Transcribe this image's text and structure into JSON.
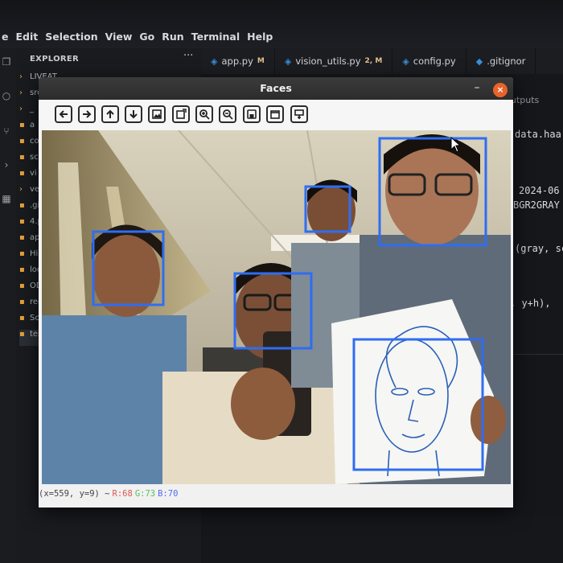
{
  "menu": [
    "e",
    "Edit",
    "Selection",
    "View",
    "Go",
    "Run",
    "Terminal",
    "Help"
  ],
  "explorer": {
    "title": "EXPLORER",
    "more_icon": "ellipsis-icon",
    "rows": [
      "LIVEAT",
      "src",
      "_",
      "a",
      "co",
      "sc",
      "vi",
      "ver",
      ".git",
      "4.p",
      "app",
      "Hir",
      "loc",
      "OD",
      "rec",
      "Scr",
      "tes"
    ]
  },
  "tabs": [
    {
      "label": "app.py",
      "badge": "M",
      "icon": "python-file-icon"
    },
    {
      "label": "vision_utils.py",
      "badge": "2, M",
      "icon": "python-file-icon"
    },
    {
      "label": "config.py",
      "badge": "",
      "icon": "python-file-icon"
    },
    {
      "label": ".gitignor",
      "badge": "",
      "icon": "git-file-icon"
    }
  ],
  "editor": {
    "outputs_label": "utputs",
    "code_fragments": [
      "data.haa",
      "2024-06",
      "BGR2GRAY",
      "(gray, sc",
      ", y+h),"
    ]
  },
  "window": {
    "title": "Faces",
    "minimize_label": "–",
    "close_label": "×",
    "toolbar": [
      {
        "name": "pan-left-icon"
      },
      {
        "name": "pan-right-icon"
      },
      {
        "name": "pan-up-icon"
      },
      {
        "name": "pan-down-icon"
      },
      {
        "name": "zoom-in-image-icon"
      },
      {
        "name": "zoom-out-image-icon"
      },
      {
        "name": "zoom-in-icon"
      },
      {
        "name": "zoom-out-icon"
      },
      {
        "name": "save-icon"
      },
      {
        "name": "properties-icon"
      },
      {
        "name": "settings-icon"
      }
    ],
    "status": {
      "coords": "(x=559, y=9) ~",
      "r": "R:68",
      "g": "G:73",
      "b": "B:70"
    },
    "colors": {
      "detection_box": "#2f6df2",
      "r": "#e05555",
      "g": "#55c060",
      "b": "#4f6cf0"
    }
  }
}
